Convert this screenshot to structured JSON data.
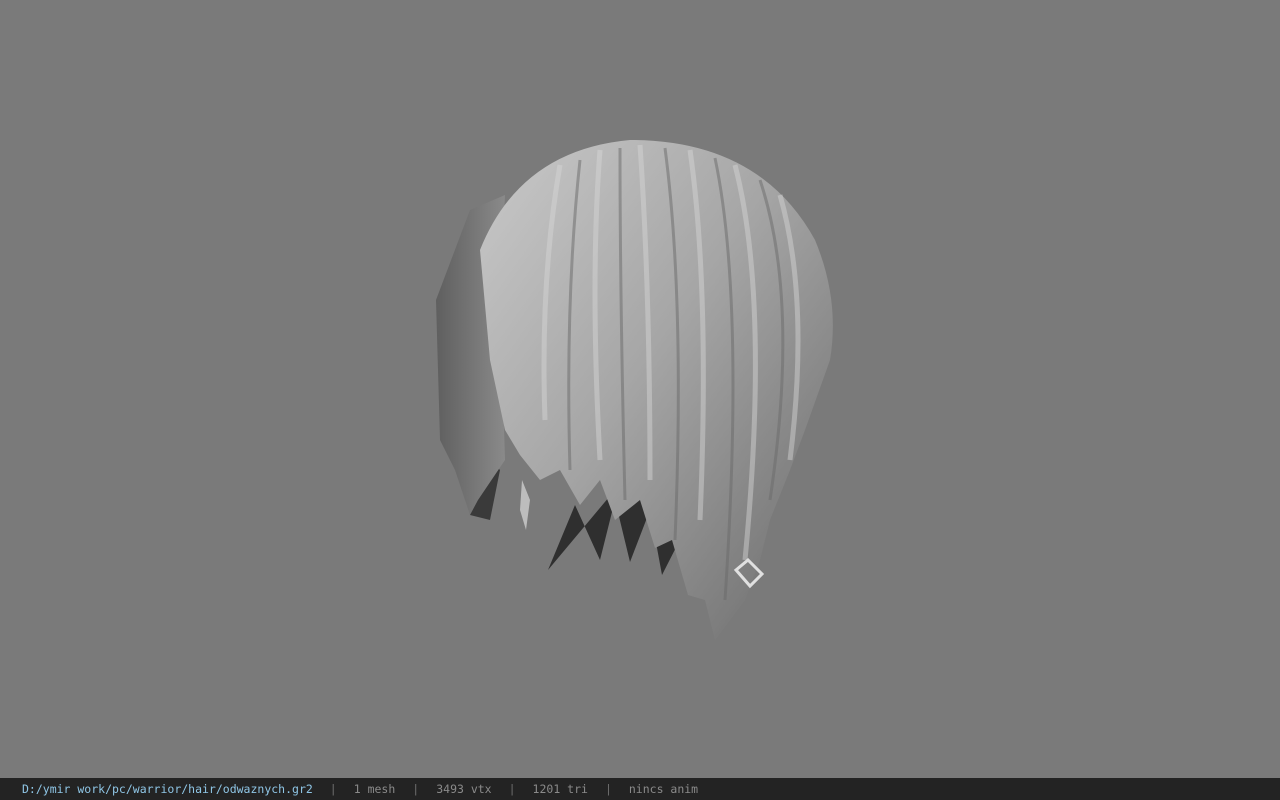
{
  "viewport": {
    "background_color": "#7a7a7a",
    "model_icon": "hair-mesh-model"
  },
  "status_bar": {
    "file_path": "D:/ymir work/pc/warrior/hair/odwaznych.gr2",
    "separator": "|",
    "mesh_count": "1 mesh",
    "vertex_count": "3493 vtx",
    "triangle_count": "1201 tri",
    "animation": "nincs anim",
    "path_color": "#8fc6e6",
    "background_color": "#232323"
  }
}
